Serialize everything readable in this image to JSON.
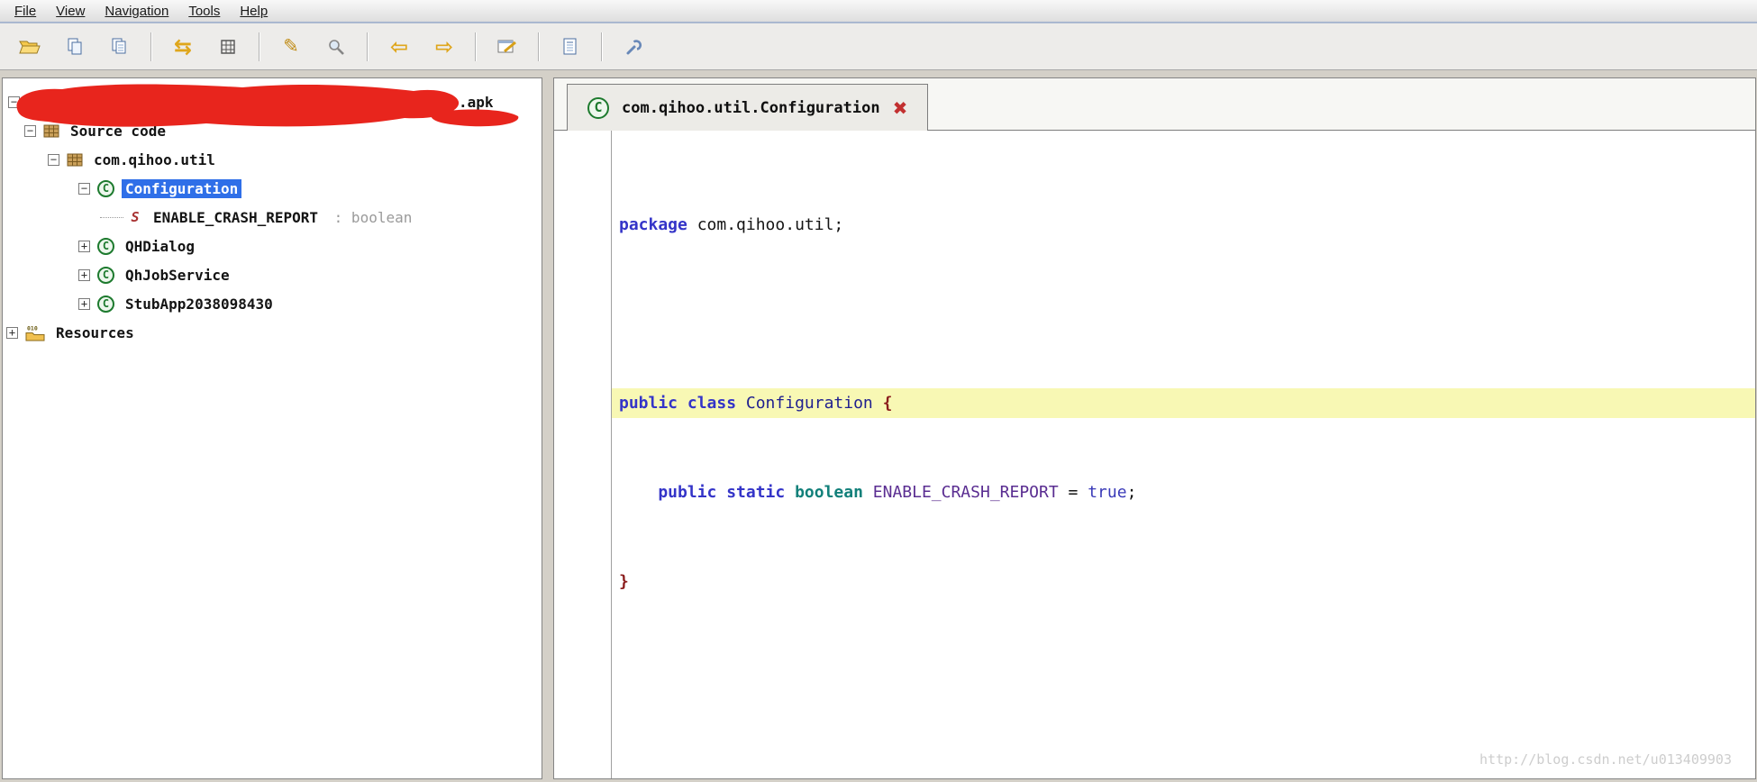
{
  "menu": {
    "items": [
      "File",
      "View",
      "Navigation",
      "Tools",
      "Help"
    ]
  },
  "toolbar": {
    "icons": [
      "open-folder",
      "copy",
      "paste",
      "refresh",
      "grid",
      "wand",
      "search",
      "back",
      "forward",
      "edit-window",
      "report",
      "wrench"
    ]
  },
  "tree": {
    "resources_badge": "010",
    "rows": [
      {
        "label": ".apk"
      },
      {
        "label": "Source code"
      },
      {
        "label": "com.qihoo.util"
      },
      {
        "label": "Configuration",
        "selected": true
      },
      {
        "label": "ENABLE_CRASH_REPORT",
        "sublabel": " : boolean"
      },
      {
        "label": "QHDialog"
      },
      {
        "label": "QhJobService"
      },
      {
        "label": "StubApp2038098430"
      },
      {
        "label": "Resources"
      }
    ]
  },
  "editor": {
    "tab": {
      "label": "com.qihoo.util.Configuration",
      "close": "✖"
    }
  },
  "code": {
    "l1_kw": "package",
    "l1_rest": " com.qihoo.util;",
    "l3_kw": "public class",
    "l3_name": " Configuration ",
    "l3_brace": "{",
    "l4_kw": "    public static",
    "l4_type": " boolean",
    "l4_field": " ENABLE_CRASH_REPORT",
    "l4_eq": " =",
    "l4_val": " true",
    "l4_semi": ";",
    "l5_brace": "}"
  },
  "watermark": "http://blog.csdn.net/u013409903",
  "colors": {
    "selection": "#2f6fe8",
    "line_highlight": "#f8f8b4",
    "keyword": "#3434c8",
    "type_keyword": "#12807a",
    "redaction": "#e8251d"
  }
}
